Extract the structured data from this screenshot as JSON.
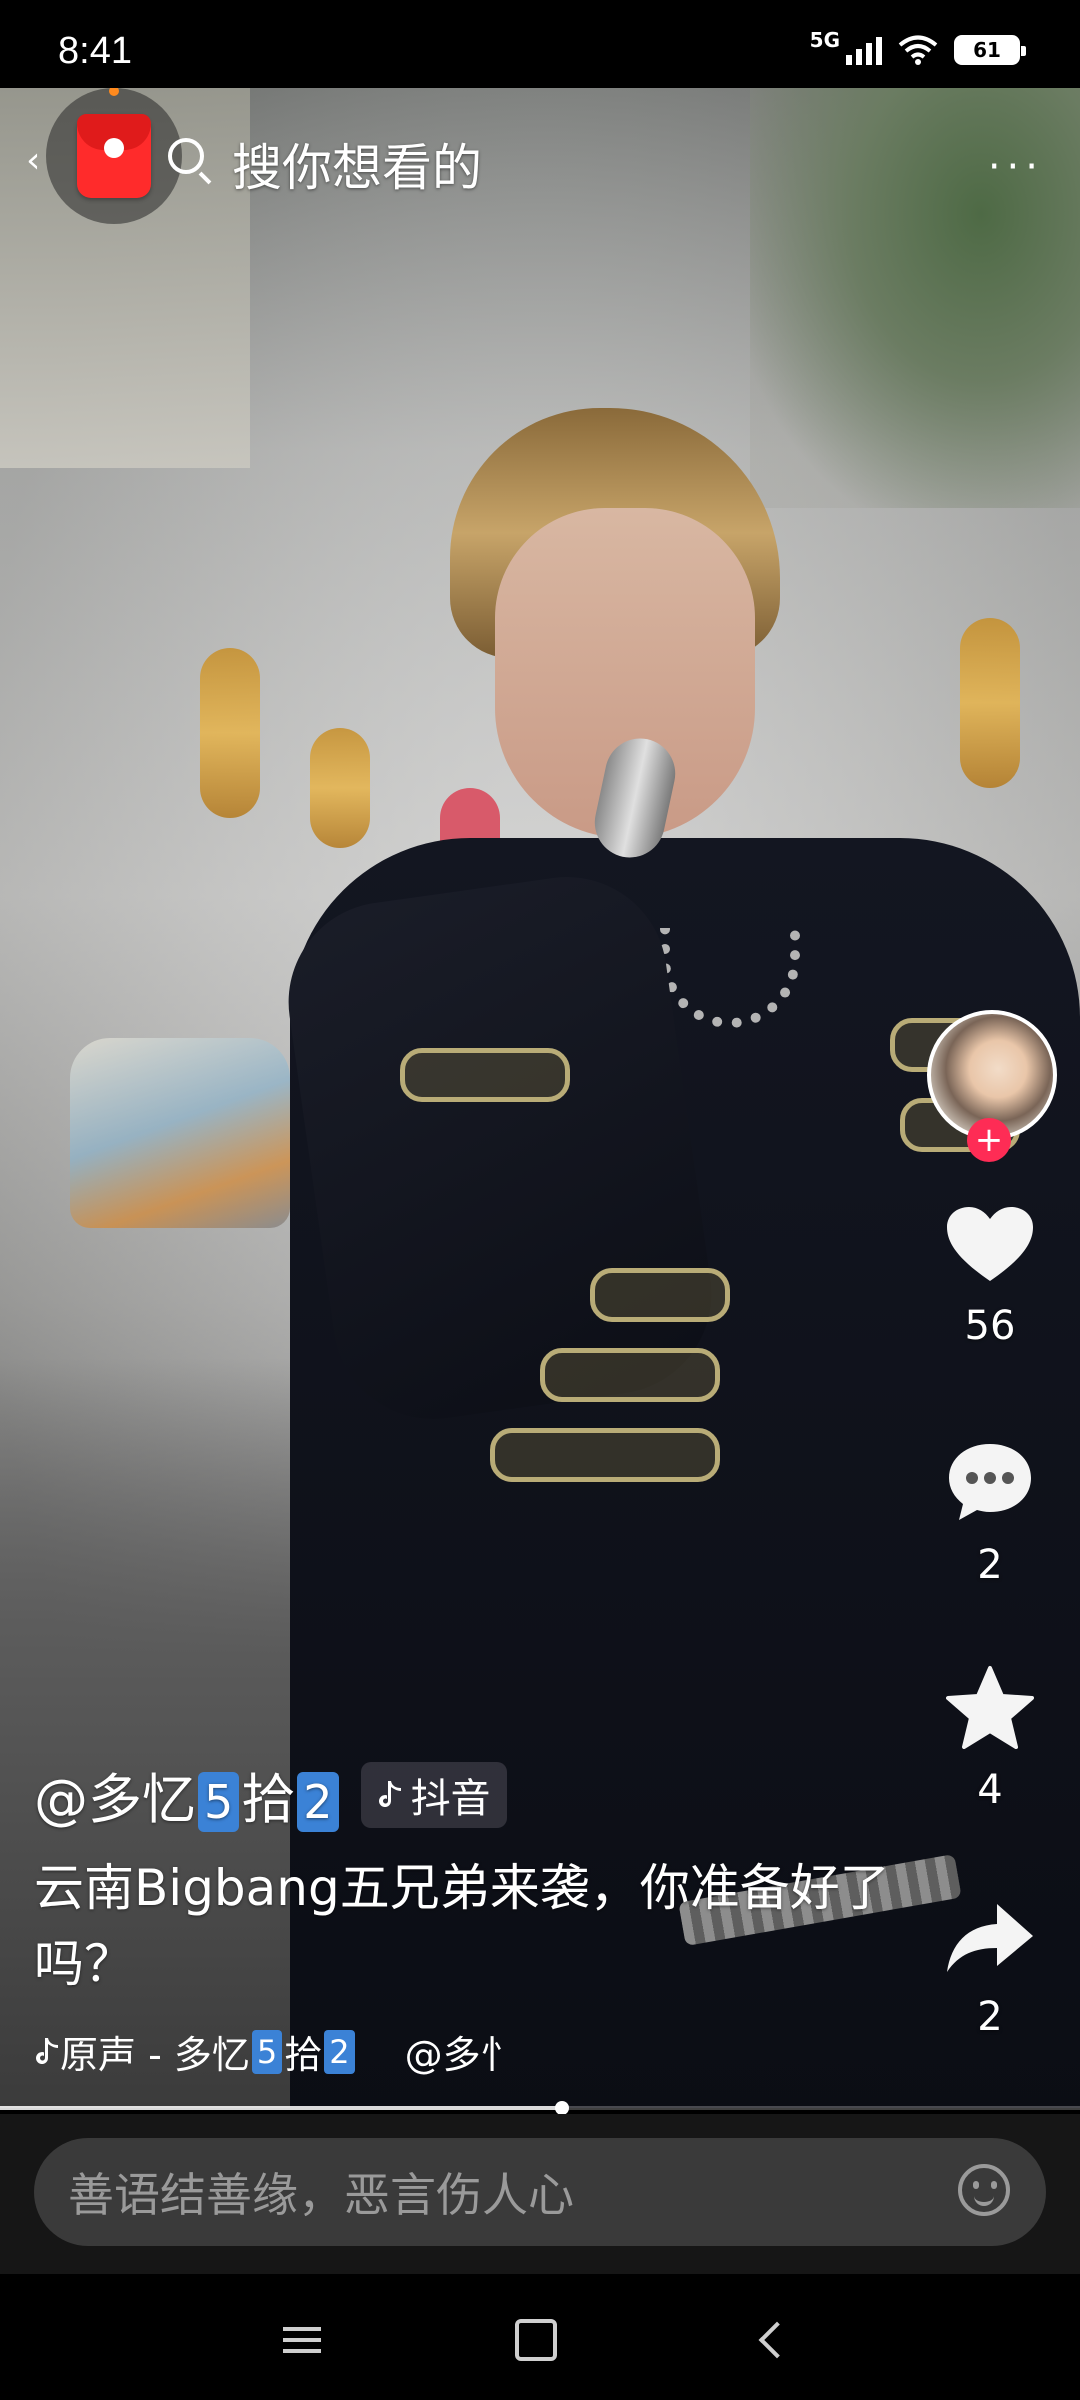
{
  "status_bar": {
    "time": "8:41",
    "network": "5G",
    "battery": "61"
  },
  "search": {
    "placeholder_text": "搜你想看的",
    "icon": "search-icon",
    "left_icon": "red-packet-icon",
    "more_icon": "more-dots-icon"
  },
  "actions": {
    "avatar_icon": "creator-avatar",
    "follow_icon": "plus-icon",
    "like_count": "56",
    "comment_count": "2",
    "favorite_count": "4",
    "share_count": "2"
  },
  "caption": {
    "author_prefix": "@多忆",
    "author_badge_1": "5",
    "author_mid": "拾",
    "author_badge_2": "2",
    "platform_tag": "抖音",
    "description": "云南Bigbang五兄弟来袭，你准备好了吗？",
    "music_prefix": "原声 - 多忆",
    "music_badge_1": "5",
    "music_mid": "拾",
    "music_badge_2": "2",
    "mention": "@多忄"
  },
  "progress": {
    "fraction": 0.52
  },
  "comment": {
    "placeholder": "善语结善缘，恶言伤人心",
    "emoji_icon": "emoji-icon"
  },
  "nav": {
    "menu_icon": "menu-icon",
    "home_icon": "home-icon",
    "back_icon": "back-icon"
  },
  "colors": {
    "accent_red": "#fe2c55",
    "badge_blue": "#3b82d6"
  }
}
